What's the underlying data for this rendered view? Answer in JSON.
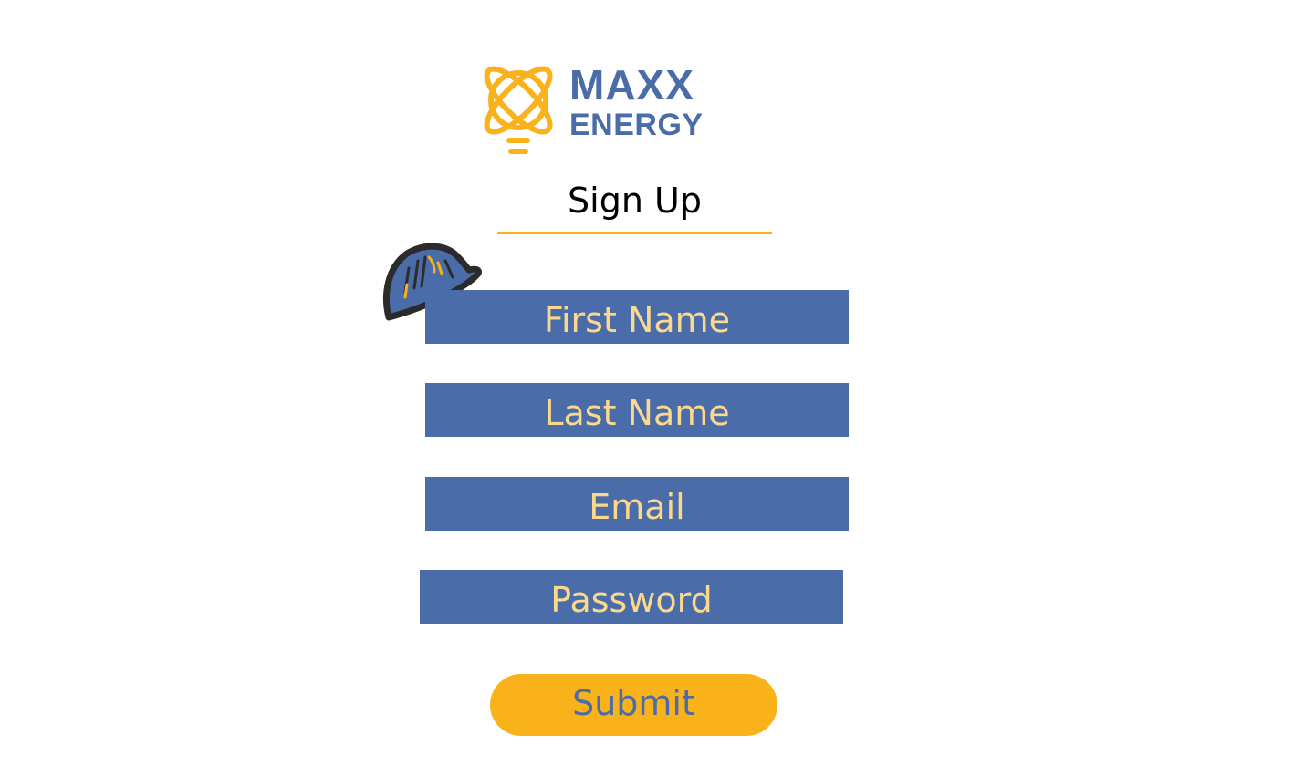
{
  "brand": {
    "line1": "MAXX",
    "line2": "ENERGY",
    "primary_color": "#4a6ca8",
    "accent_color": "#f9b21a",
    "icon": "lightbulb-atom-logo-icon"
  },
  "page": {
    "title": "Sign Up"
  },
  "decor": {
    "icon": "hard-hat-icon"
  },
  "form": {
    "first_name": {
      "label": "First Name"
    },
    "last_name": {
      "label": "Last Name"
    },
    "email": {
      "label": "Email"
    },
    "password": {
      "label": "Password"
    },
    "submit_label": "Submit",
    "field_color": "#4a6ca8",
    "field_text_color": "#fbd88c"
  }
}
